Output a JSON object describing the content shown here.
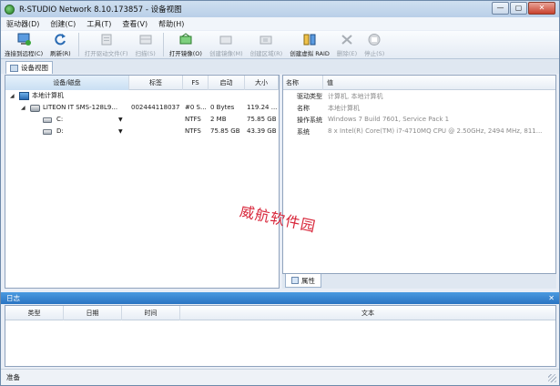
{
  "app": {
    "title": "R-STUDIO Network 8.10.173857 - 设备视图",
    "window_controls": {
      "minimize": "—",
      "maximize": "▢",
      "close": "✕"
    }
  },
  "menu": [
    "驱动器(D)",
    "创建(C)",
    "工具(T)",
    "查看(V)",
    "帮助(H)"
  ],
  "toolbar": [
    {
      "label": "连接到远程(C)",
      "icon": "connect-remote-icon",
      "enabled": true
    },
    {
      "label": "刷新(R)",
      "icon": "refresh-icon",
      "enabled": true
    },
    {
      "label": "打开驱动文件(F)",
      "icon": "open-drive-file-icon",
      "enabled": false
    },
    {
      "label": "扫描(S)",
      "icon": "scan-icon",
      "enabled": false
    },
    {
      "label": "打开镜像(O)",
      "icon": "open-image-icon",
      "enabled": true
    },
    {
      "label": "创建镜像(M)",
      "icon": "create-image-icon",
      "enabled": false
    },
    {
      "label": "创建区域(R)",
      "icon": "create-region-icon",
      "enabled": false
    },
    {
      "label": "创建虚拟 RAID",
      "icon": "create-virtual-raid-icon",
      "enabled": true
    },
    {
      "label": "删除(E)",
      "icon": "delete-icon",
      "enabled": false
    },
    {
      "label": "停止(S)",
      "icon": "stop-icon",
      "enabled": false
    }
  ],
  "tabs": {
    "device_view": "设备视图"
  },
  "device_table": {
    "headers": [
      "设备/磁盘",
      "标签",
      "FS",
      "启动",
      "大小"
    ],
    "rows": [
      {
        "name": "本地计算机",
        "label": "",
        "fs": "",
        "start": "",
        "size": "",
        "level": 0,
        "type": "computer"
      },
      {
        "name": "LITEON IT SMS-128L9...",
        "label": "002444118037",
        "fs": "#0 S...",
        "start": "0 Bytes",
        "size": "119.24 ...",
        "level": 1,
        "type": "disk"
      },
      {
        "name": "C:",
        "label": "",
        "fs": "NTFS",
        "start": "2 MB",
        "size": "75.85 GB",
        "level": 2,
        "type": "volume"
      },
      {
        "name": "D:",
        "label": "",
        "fs": "NTFS",
        "start": "75.85 GB",
        "size": "43.39 GB",
        "level": 2,
        "type": "volume"
      }
    ]
  },
  "properties": {
    "headers": [
      "名称",
      "值"
    ],
    "rows": [
      {
        "key": "驱动类型",
        "value": "计算机, 本地计算机"
      },
      {
        "key": "名称",
        "value": "本地计算机"
      },
      {
        "key": "操作系统",
        "value": "Windows 7 Build 7601, Service Pack 1"
      },
      {
        "key": "系统",
        "value": "8 x Intel(R) Core(TM) i7-4710MQ CPU @ 2.50GHz, 2494 MHz, 811..."
      }
    ],
    "tab": "属性"
  },
  "watermark": "威航软件园",
  "log": {
    "title": "日志",
    "close": "✕",
    "headers": [
      "类型",
      "日期",
      "时间",
      "文本"
    ]
  },
  "status": {
    "text": "准备"
  }
}
